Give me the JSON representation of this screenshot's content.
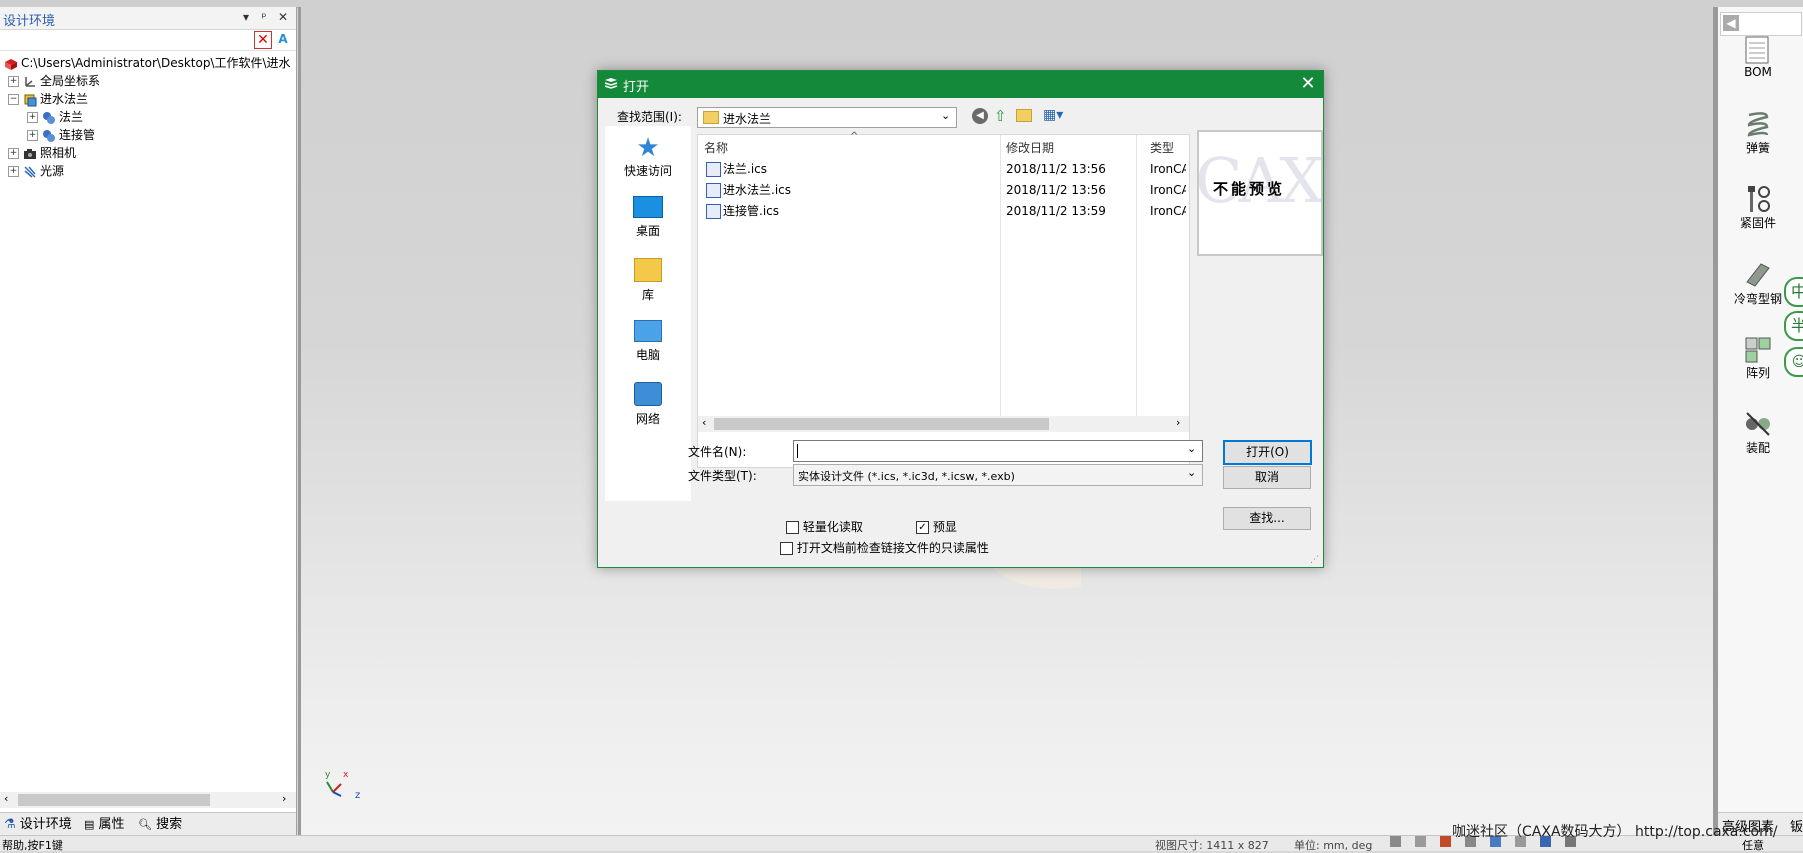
{
  "left_panel": {
    "title": "设计环境",
    "tree": [
      {
        "label": "C:\\Users\\Administrator\\Desktop\\工作软件\\进水"
      },
      {
        "label": "全局坐标系"
      },
      {
        "label": "进水法兰"
      },
      {
        "label": "法兰"
      },
      {
        "label": "连接管"
      },
      {
        "label": "照相机"
      },
      {
        "label": "光源"
      }
    ],
    "tabs": {
      "design": "设计环境",
      "props": "属性",
      "search": "搜索"
    }
  },
  "right_panel": {
    "items": [
      "BOM",
      "弹簧",
      "紧固件",
      "冷弯型钢",
      "阵列",
      "装配"
    ],
    "bottom_tab": "高级图素",
    "bottom_tab2": "钣"
  },
  "statusbar": {
    "help": "帮助,按F1键",
    "view_size": "视图尺寸: 1411 x 827",
    "units": "单位: mm, deg",
    "watermark": "咖迷社区（CAXA数码大方） http://top.caxa.com/",
    "task": "任意"
  },
  "dialog": {
    "title": "打开",
    "look_in_label": "查找范围(I):",
    "look_in_value": "进水法兰",
    "places": [
      "快速访问",
      "桌面",
      "库",
      "电脑",
      "网络"
    ],
    "columns": {
      "name": "名称",
      "date": "修改日期",
      "type": "类型"
    },
    "files": [
      {
        "name": "法兰.ics",
        "date": "2018/11/2 13:56",
        "type": "IronCAI"
      },
      {
        "name": "进水法兰.ics",
        "date": "2018/11/2 13:56",
        "type": "IronCAI"
      },
      {
        "name": "连接管.ics",
        "date": "2018/11/2 13:59",
        "type": "IronCAI"
      }
    ],
    "preview_text": "不能预览",
    "preview_watermark": "CAXA",
    "filename_label": "文件名(N):",
    "filename_value": "",
    "filetype_label": "文件类型(T):",
    "filetype_value": "实体设计文件 (*.ics, *.ic3d, *.icsw, *.exb)",
    "open_button": "打开(O)",
    "cancel_button": "取消",
    "find_button": "查找...",
    "lightweight_label": "轻量化读取",
    "lightweight_checked": false,
    "preview_label": "预显",
    "preview_checked": true,
    "readonly_label": "打开文档前检查链接文件的只读属性",
    "readonly_checked": false
  },
  "axes": {
    "x": "x",
    "y": "y",
    "z": "z"
  },
  "colors": {
    "title_bar": "#15893a",
    "accent_blue": "#2a5db0"
  }
}
